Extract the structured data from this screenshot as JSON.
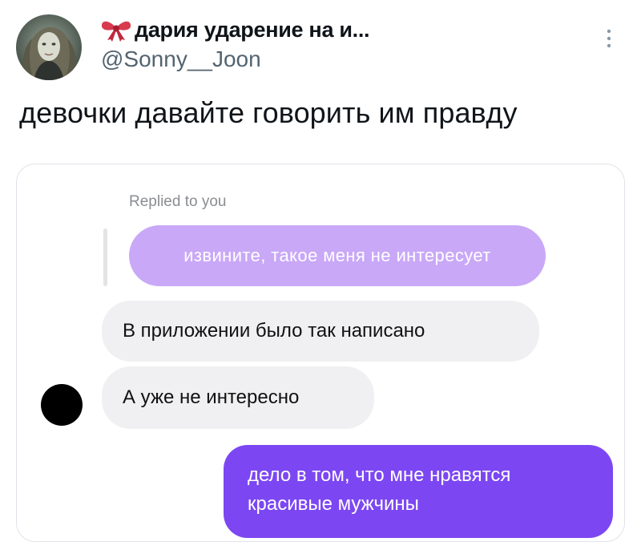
{
  "tweet": {
    "display_name": "дария ударение на и...",
    "handle": "@Sonny__Joon",
    "text": "девочки давайте говорить им правду"
  },
  "icons": {
    "name_emoji": "ribbon-bow-icon",
    "more": "more-vertical-icon"
  },
  "chat": {
    "replied_label": "Replied to you",
    "quoted_message": "извините, такое меня не интересует",
    "messages": [
      "В приложении было так написано",
      "А уже не интересно"
    ],
    "my_message_lines": [
      "дело в том, что мне нравятся",
      "красивые мужчины"
    ]
  },
  "colors": {
    "quoted_bubble": "#c9a8f7",
    "my_bubble": "#7c47f2",
    "incoming_bubble": "#f0f0f2",
    "handle_text": "#536471"
  }
}
